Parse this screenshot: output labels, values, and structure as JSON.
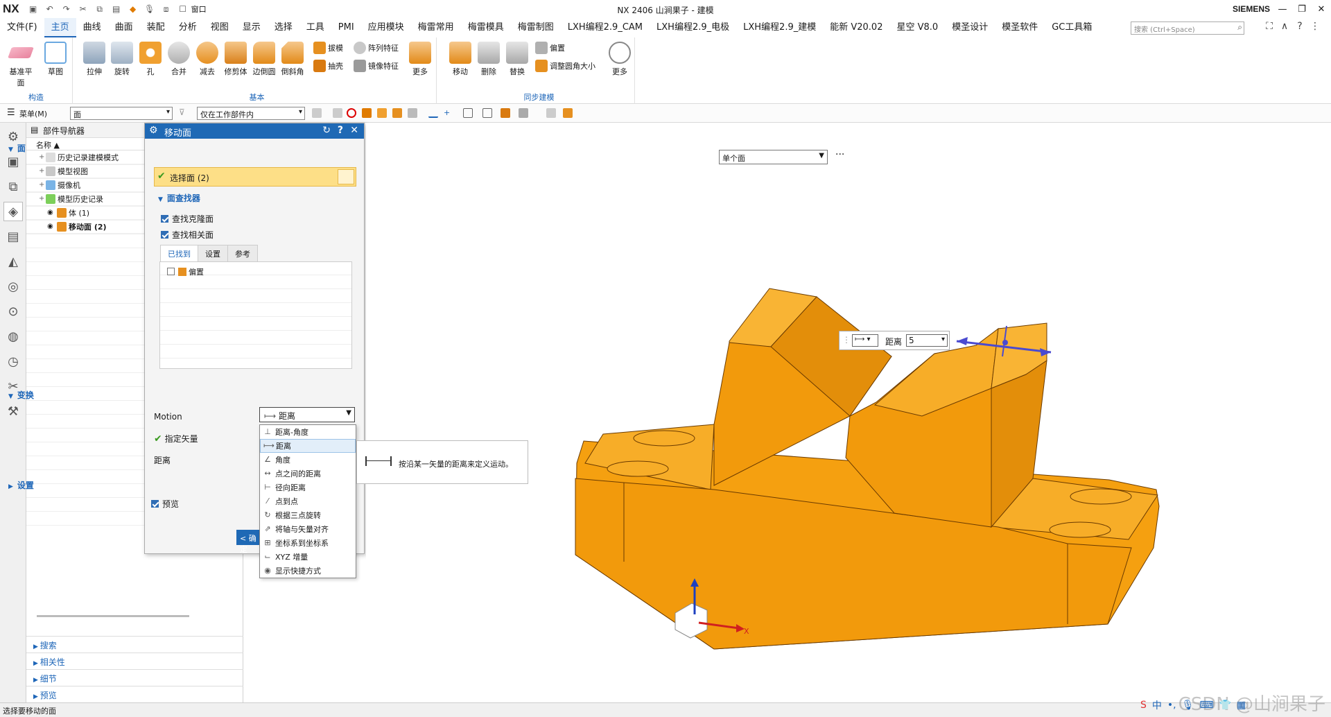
{
  "titlebar": {
    "logo": "NX",
    "title": "NX 2406 山涧果子 - 建模",
    "brand": "SIEMENS",
    "window_menu": "窗口"
  },
  "menu": {
    "items": [
      "文件(F)",
      "主页",
      "曲线",
      "曲面",
      "装配",
      "分析",
      "视图",
      "显示",
      "选择",
      "工具",
      "PMI",
      "应用模块",
      "梅雷常用",
      "梅雷模具",
      "梅雷制图",
      "LXH编程2.9_CAM",
      "LXH编程2.9_电极",
      "LXH编程2.9_建模",
      "能新 V20.02",
      "星空 V8.0",
      "模圣设计",
      "模圣软件",
      "GC工具箱"
    ],
    "active_index": 1,
    "search_placeholder": "搜索 (Ctrl+Space)"
  },
  "ribbon": {
    "groups": [
      {
        "label": "构造",
        "buttons": [
          "基准平面",
          "草图"
        ]
      },
      {
        "label": "基本",
        "buttons": [
          "拉伸",
          "旋转",
          "孔",
          "合并",
          "减去",
          "修剪体",
          "边倒圆",
          "倒斜角"
        ],
        "small": [
          "拔模",
          "阵列特征",
          "抽壳",
          "镜像特征"
        ],
        "more": "更多"
      },
      {
        "label": "同步建模",
        "buttons": [
          "移动",
          "删除",
          "替换"
        ],
        "small": [
          "偏置",
          "调整圆角大小"
        ],
        "more": "更多"
      }
    ]
  },
  "filterbar": {
    "menu_label": "菜单(M)",
    "type_filter": "面",
    "scope_filter": "仅在工作部件内"
  },
  "navigator": {
    "title": "部件导航器",
    "column": "名称",
    "items": [
      {
        "label": "历史记录建模模式",
        "indent": 1
      },
      {
        "label": "模型视图",
        "indent": 1
      },
      {
        "label": "摄像机",
        "indent": 1
      },
      {
        "label": "模型历史记录",
        "indent": 1
      },
      {
        "label": "体 (1)",
        "indent": 2
      },
      {
        "label": "移动面 (2)",
        "indent": 2,
        "bold": true
      }
    ],
    "bottom_sections": [
      "搜索",
      "相关性",
      "细节",
      "预览"
    ]
  },
  "dialog": {
    "title": "移动面",
    "face_section": "面",
    "select_face": "选择面 (2)",
    "face_finder": "面查找器",
    "find_clone": "查找克隆面",
    "find_related": "查找相关面",
    "tabs": [
      "已找到",
      "设置",
      "参考"
    ],
    "found_item": "偏置",
    "transform_section": "变换",
    "motion_label": "Motion",
    "motion_value": "距离",
    "specify_vector": "指定矢量",
    "distance_label": "距离",
    "settings_section": "设置",
    "preview_label": "预览",
    "ok_label": "< 确定"
  },
  "motion_options": [
    {
      "label": "距离-角度",
      "icon": "distance-angle-icon"
    },
    {
      "label": "距离",
      "icon": "distance-icon",
      "highlighted": true
    },
    {
      "label": "角度",
      "icon": "angle-icon"
    },
    {
      "label": "点之间的距离",
      "icon": "point-distance-icon"
    },
    {
      "label": "径向距离",
      "icon": "radial-distance-icon"
    },
    {
      "label": "点到点",
      "icon": "point-to-point-icon"
    },
    {
      "label": "根据三点旋转",
      "icon": "three-point-rotate-icon"
    },
    {
      "label": "将轴与矢量对齐",
      "icon": "align-axis-icon"
    },
    {
      "label": "坐标系到坐标系",
      "icon": "csys-icon"
    },
    {
      "label": "XYZ 增量",
      "icon": "xyz-icon"
    },
    {
      "label": "显示快捷方式",
      "icon": "shortcut-icon"
    }
  ],
  "tooltip": {
    "text": "按沿某一矢量的距离来定义运动。"
  },
  "viewport": {
    "selection_dropdown": "单个面",
    "float_label": "距离",
    "float_value": "5",
    "axis_x": "X",
    "colors": {
      "part": "#f5a010",
      "part_shade": "#d98a08"
    }
  },
  "statusbar": {
    "text": "选择要移动的面"
  },
  "watermark": "CSDN @山涧果子",
  "ime": {
    "mode": "中"
  }
}
